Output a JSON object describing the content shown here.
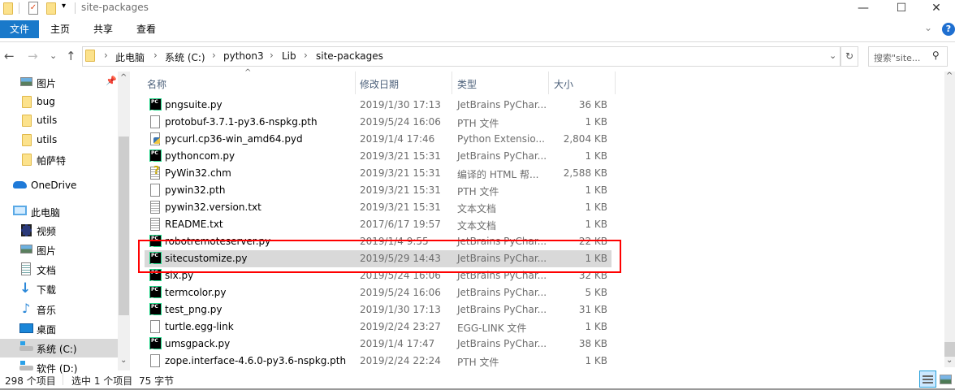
{
  "window": {
    "title": "site-packages",
    "minimize": "—",
    "maximize": "☐",
    "close": "✕"
  },
  "ribbon": {
    "tabs": [
      "文件",
      "主页",
      "共享",
      "查看"
    ],
    "expand": "⌄",
    "help": "?"
  },
  "address": {
    "back": "←",
    "forward": "→",
    "recent": "⌄",
    "up": "↑",
    "crumbs": [
      "此电脑",
      "系统 (C:)",
      "python3",
      "Lib",
      "site-packages"
    ],
    "chevron": "›",
    "dropdown": "⌄",
    "refresh": "↻",
    "search_placeholder": "搜索\"site...",
    "search_icon": "⚲"
  },
  "nav": {
    "items": [
      {
        "label": "图片",
        "icon": "pictures-icon",
        "pinned": true
      },
      {
        "label": "bug",
        "icon": "folder-icon"
      },
      {
        "label": "utils",
        "icon": "folder-icon"
      },
      {
        "label": "utils",
        "icon": "folder-icon"
      },
      {
        "label": "帕萨特",
        "icon": "folder-icon"
      },
      {
        "label": "OneDrive",
        "icon": "onedrive-icon"
      },
      {
        "label": "此电脑",
        "icon": "computer-icon"
      },
      {
        "label": "视频",
        "icon": "videos-icon"
      },
      {
        "label": "图片",
        "icon": "pictures-icon"
      },
      {
        "label": "文档",
        "icon": "documents-icon"
      },
      {
        "label": "下载",
        "icon": "downloads-icon"
      },
      {
        "label": "音乐",
        "icon": "music-icon"
      },
      {
        "label": "桌面",
        "icon": "desktop-icon"
      },
      {
        "label": "系统 (C:)",
        "icon": "drive-icon",
        "selected": true
      },
      {
        "label": "软件 (D:)",
        "icon": "drive-icon"
      }
    ]
  },
  "columns": {
    "name": "名称",
    "date": "修改日期",
    "type": "类型",
    "size": "大小",
    "sort_arrow": "^"
  },
  "files": [
    {
      "name": "pngsuite.py",
      "date": "2019/1/30 17:13",
      "type": "JetBrains PyChar...",
      "size": "36 KB",
      "icon": "pc"
    },
    {
      "name": "protobuf-3.7.1-py3.6-nspkg.pth",
      "date": "2019/5/24 16:06",
      "type": "PTH 文件",
      "size": "1 KB",
      "icon": "file"
    },
    {
      "name": "pycurl.cp36-win_amd64.pyd",
      "date": "2019/1/4 17:46",
      "type": "Python Extensio...",
      "size": "2,804 KB",
      "icon": "pyd"
    },
    {
      "name": "pythoncom.py",
      "date": "2019/3/21 15:31",
      "type": "JetBrains PyChar...",
      "size": "1 KB",
      "icon": "pc"
    },
    {
      "name": "PyWin32.chm",
      "date": "2019/3/21 15:31",
      "type": "编译的 HTML 帮...",
      "size": "2,588 KB",
      "icon": "chm"
    },
    {
      "name": "pywin32.pth",
      "date": "2019/3/21 15:31",
      "type": "PTH 文件",
      "size": "1 KB",
      "icon": "file"
    },
    {
      "name": "pywin32.version.txt",
      "date": "2019/3/21 15:31",
      "type": "文本文档",
      "size": "1 KB",
      "icon": "txt"
    },
    {
      "name": "README.txt",
      "date": "2017/6/17 19:57",
      "type": "文本文档",
      "size": "1 KB",
      "icon": "txt"
    },
    {
      "name": "robotremoteserver.py",
      "date": "2019/1/4 9:55",
      "type": "JetBrains PyChar...",
      "size": "22 KB",
      "icon": "pc"
    },
    {
      "name": "sitecustomize.py",
      "date": "2019/5/29 14:43",
      "type": "JetBrains PyChar...",
      "size": "1 KB",
      "icon": "pc",
      "selected": true
    },
    {
      "name": "six.py",
      "date": "2019/5/24 16:06",
      "type": "JetBrains PyChar...",
      "size": "32 KB",
      "icon": "pc"
    },
    {
      "name": "termcolor.py",
      "date": "2019/5/24 16:06",
      "type": "JetBrains PyChar...",
      "size": "5 KB",
      "icon": "pc"
    },
    {
      "name": "test_png.py",
      "date": "2019/1/30 17:13",
      "type": "JetBrains PyChar...",
      "size": "31 KB",
      "icon": "pc"
    },
    {
      "name": "turtle.egg-link",
      "date": "2019/2/24 23:27",
      "type": "EGG-LINK 文件",
      "size": "1 KB",
      "icon": "file"
    },
    {
      "name": "umsgpack.py",
      "date": "2019/1/4 17:47",
      "type": "JetBrains PyChar...",
      "size": "38 KB",
      "icon": "pc"
    },
    {
      "name": "zope.interface-4.6.0-py3.6-nspkg.pth",
      "date": "2019/2/24 22:24",
      "type": "PTH 文件",
      "size": "1 KB",
      "icon": "file"
    }
  ],
  "status": {
    "count": "298 个项目",
    "selected": "选中 1 个项目",
    "size": "75 字节"
  },
  "colors": {
    "accent": "#1979ca",
    "highlight": "#ff0000",
    "selected_row": "#d9d9d9"
  }
}
